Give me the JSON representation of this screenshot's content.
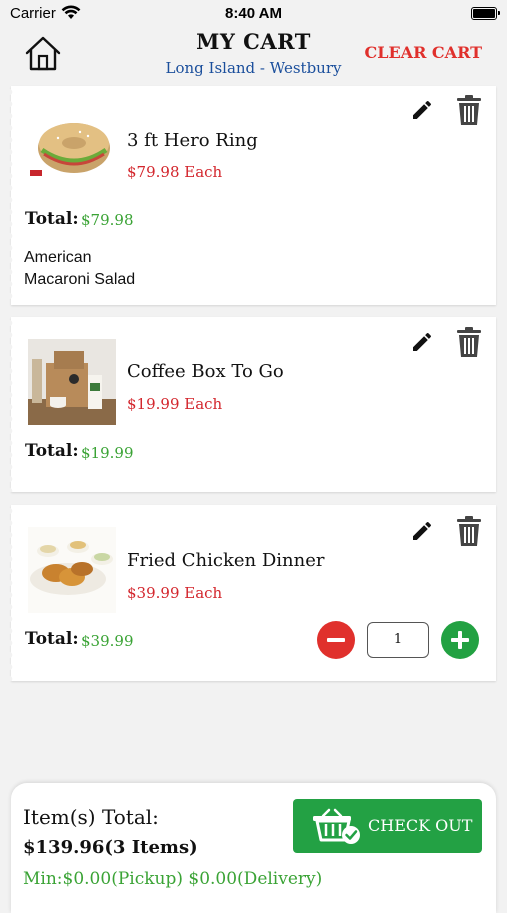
{
  "status_bar": {
    "carrier": "Carrier",
    "time": "8:40 AM"
  },
  "header": {
    "title": "MY CART",
    "location": "Long Island - Westbury",
    "clear_label": "CLEAR CART"
  },
  "cart_items": [
    {
      "name": "3 ft Hero Ring",
      "price": "$79.98 Each",
      "total_label": "Total:",
      "total": "$79.98",
      "options": [
        "American",
        "Macaroni Salad"
      ]
    },
    {
      "name": "Coffee Box To Go",
      "price": "$19.99 Each",
      "total_label": "Total:",
      "total": "$19.99"
    },
    {
      "name": "Fried Chicken Dinner",
      "price": "$39.99 Each",
      "total_label": "Total:",
      "total": "$39.99",
      "quantity": "1"
    }
  ],
  "footer": {
    "items_total_label": "Item(s) Total:",
    "items_total_value": "$139.96(3 Items)",
    "minimum_text": "Min:$0.00(Pickup) $0.00(Delivery)",
    "checkout_label": "CHECK OUT"
  },
  "colors": {
    "price_red": "#d3262d",
    "total_green": "#3aa335",
    "checkout_green": "#23a144",
    "location_blue": "#1b4f9c"
  },
  "icons": [
    "wifi-icon",
    "home-icon",
    "edit-icon",
    "trash-icon",
    "minus-icon",
    "plus-icon",
    "basket-check-icon"
  ]
}
